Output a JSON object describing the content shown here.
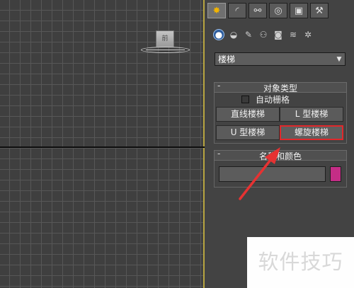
{
  "viewport": {
    "cube_label": "前"
  },
  "command_panel": {
    "tabs": [
      {
        "name": "create",
        "glyph": "✸"
      },
      {
        "name": "modify",
        "glyph": "◜"
      },
      {
        "name": "hierarchy",
        "glyph": "⚯"
      },
      {
        "name": "motion",
        "glyph": "◎"
      },
      {
        "name": "display",
        "glyph": "▣"
      },
      {
        "name": "utilities",
        "glyph": "⚒"
      }
    ],
    "sub_tabs": [
      {
        "name": "geometry",
        "glyph": "●"
      },
      {
        "name": "shapes",
        "glyph": "◒"
      },
      {
        "name": "lights",
        "glyph": "✎"
      },
      {
        "name": "cameras",
        "glyph": "⚇"
      },
      {
        "name": "helpers",
        "glyph": "◙"
      },
      {
        "name": "space-warps",
        "glyph": "≋"
      },
      {
        "name": "systems",
        "glyph": "✲"
      }
    ],
    "category_dropdown": {
      "selected": "楼梯"
    },
    "object_type": {
      "header": "对象类型",
      "collapse": "-",
      "autogrid_label": "自动栅格",
      "buttons": [
        "直线楼梯",
        "L 型楼梯",
        "U 型楼梯",
        "螺旋楼梯"
      ],
      "selected_button": "螺旋楼梯"
    },
    "name_color": {
      "header": "名称和颜色",
      "collapse": "-",
      "name_value": "",
      "color": "#c42d86"
    }
  },
  "annotation": {
    "highlight_color": "#e0282b",
    "arrow_color": "#e63232"
  },
  "watermark": {
    "text": "软件技巧"
  }
}
